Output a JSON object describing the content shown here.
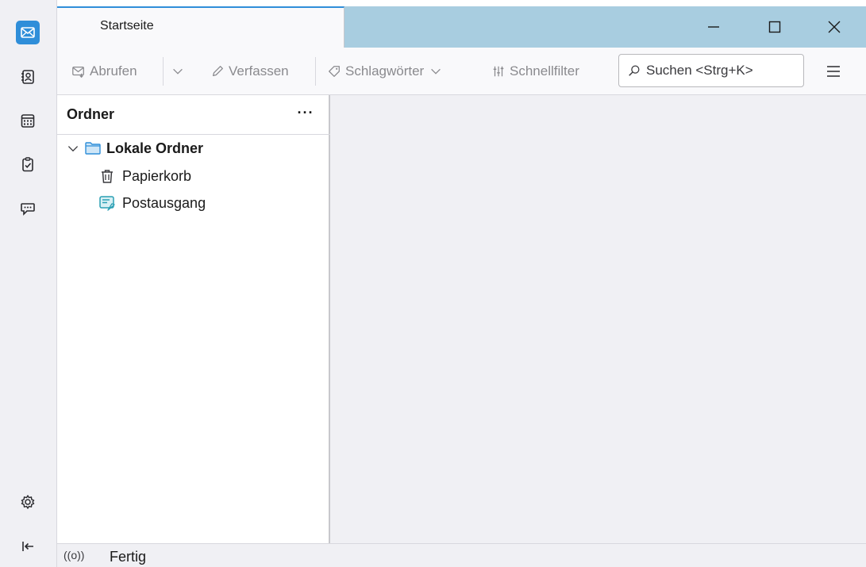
{
  "tab": {
    "title": "Startseite"
  },
  "window": {
    "minimize": "minimize-icon",
    "maximize": "maximize-icon",
    "close": "close-icon"
  },
  "toolbar": {
    "get_mail_label": "Abrufen",
    "compose_label": "Verfassen",
    "tags_label": "Schlagwörter",
    "quickfilter_label": "Schnellfilter",
    "search_placeholder": "Suchen <Strg+K>"
  },
  "folder_pane": {
    "title": "Ordner",
    "more": "···",
    "tree": [
      {
        "label": "Lokale Ordner",
        "icon": "folder-icon"
      },
      {
        "label": "Papierkorb",
        "icon": "trash-icon"
      },
      {
        "label": "Postausgang",
        "icon": "outbox-icon"
      }
    ]
  },
  "spaces": [
    "mail-icon",
    "address-book-icon",
    "calendar-icon",
    "tasks-icon",
    "chat-icon",
    "settings-icon",
    "collapse-icon"
  ],
  "status": {
    "icon": "((o))",
    "text": "Fertig"
  },
  "colors": {
    "accent": "#2f8ed9",
    "titlebar": "#a8cde0",
    "outbox": "#2a9fb4"
  }
}
